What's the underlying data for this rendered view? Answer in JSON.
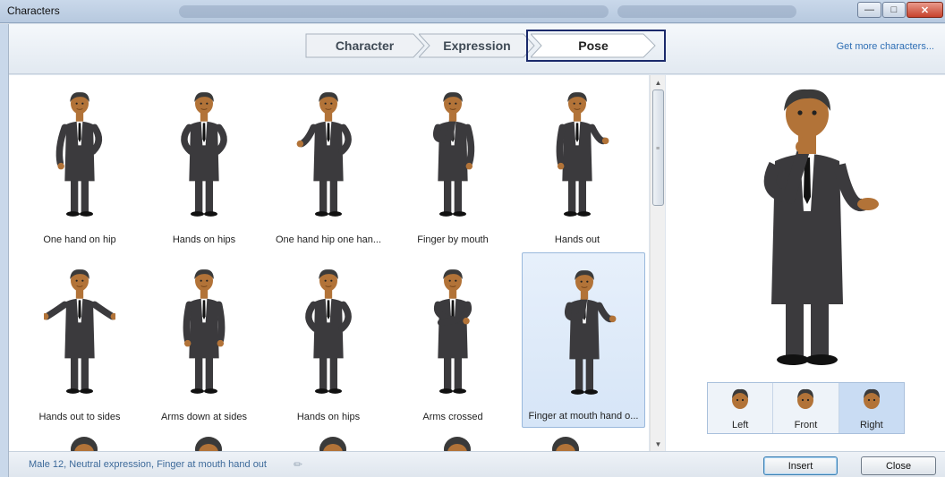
{
  "window": {
    "title": "Characters"
  },
  "steps": [
    {
      "label": "Character",
      "active": false
    },
    {
      "label": "Expression",
      "active": false
    },
    {
      "label": "Pose",
      "active": true
    }
  ],
  "header": {
    "more_link": "Get more characters..."
  },
  "poses": [
    {
      "label": "One hand on hip",
      "pose": "one-hip"
    },
    {
      "label": "Hands on hips",
      "pose": "hips"
    },
    {
      "label": "One hand hip one han...",
      "pose": "hip-out"
    },
    {
      "label": "Finger by mouth",
      "pose": "finger"
    },
    {
      "label": "Hands out",
      "pose": "hands-out"
    },
    {
      "label": "Hands out to sides",
      "pose": "sides"
    },
    {
      "label": "Arms down at sides",
      "pose": "down"
    },
    {
      "label": "Hands on hips",
      "pose": "hips"
    },
    {
      "label": "Arms crossed",
      "pose": "crossed"
    },
    {
      "label": "Finger at mouth hand o...",
      "pose": "finger-out",
      "selected": true
    }
  ],
  "views": [
    {
      "label": "Left",
      "selected": false
    },
    {
      "label": "Front",
      "selected": false
    },
    {
      "label": "Right",
      "selected": true
    }
  ],
  "status": {
    "text": "Male 12, Neutral expression, Finger at mouth hand out"
  },
  "buttons": {
    "insert": "Insert",
    "close": "Close"
  },
  "colors": {
    "suit": "#3b3a3d",
    "skin": "#b27338",
    "hair": "#3a3a3a",
    "selection": "#d6e5f7",
    "link": "#2f6fb5"
  }
}
